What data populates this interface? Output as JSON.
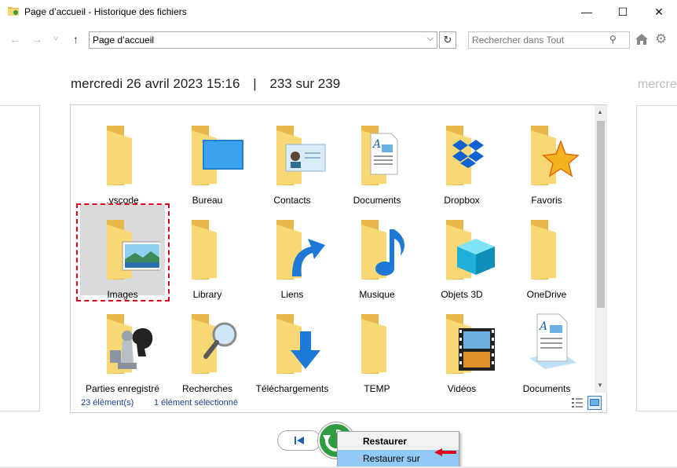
{
  "window": {
    "title": "Page d’accueil - Historique des fichiers",
    "minimize": "—",
    "maximize": "☐",
    "close": "✕"
  },
  "nav": {
    "back": "←",
    "forward": "→",
    "dropdown": "˅",
    "up": "↑",
    "address": "Page d’accueil",
    "address_dropdown": "⌵",
    "refresh": "↻",
    "search_placeholder": "Rechercher dans Tout",
    "search_icon": "⚲",
    "gear_icon": "⚙"
  },
  "heading": {
    "date": "mercredi 26 avril 2023 15:16",
    "separator": "|",
    "position": "233 sur 239",
    "next_preview": "mercre"
  },
  "items": [
    {
      "label": ".vscode",
      "icon": "folder"
    },
    {
      "label": "Bureau",
      "icon": "desktop-folder"
    },
    {
      "label": "Contacts",
      "icon": "contacts-folder"
    },
    {
      "label": "Documents",
      "icon": "documents-folder"
    },
    {
      "label": "Dropbox",
      "icon": "dropbox-folder"
    },
    {
      "label": "Favoris",
      "icon": "favorites-folder"
    },
    {
      "label": "Images",
      "icon": "pictures-folder"
    },
    {
      "label": "Library",
      "icon": "folder"
    },
    {
      "label": "Liens",
      "icon": "links-folder"
    },
    {
      "label": "Musique",
      "icon": "music-folder"
    },
    {
      "label": "Objets 3D",
      "icon": "3d-objects-folder"
    },
    {
      "label": "OneDrive",
      "icon": "folder"
    },
    {
      "label": "Parties enregistré",
      "icon": "saved-games-folder"
    },
    {
      "label": "Recherches",
      "icon": "searches-folder"
    },
    {
      "label": "Téléchargements",
      "icon": "downloads-folder"
    },
    {
      "label": "TEMP",
      "icon": "folder"
    },
    {
      "label": "Vidéos",
      "icon": "videos-folder"
    },
    {
      "label": "Documents",
      "icon": "document-file"
    }
  ],
  "status": {
    "count": "23 élément(s)",
    "selection": "1 élément sélectionné"
  },
  "context_menu": {
    "restore": "Restaurer",
    "restore_to": "Restaurer sur"
  },
  "colors": {
    "folder": "#f8d775",
    "folder_back": "#e8b94a",
    "selection_outline": "#e0001b",
    "restore_green": "#2f9c3f",
    "menu_highlight": "#91c9f7"
  }
}
